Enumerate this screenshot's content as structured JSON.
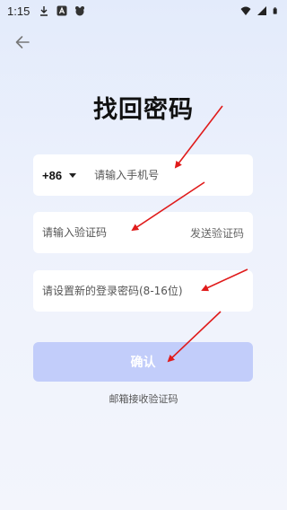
{
  "status_bar": {
    "time": "1:15",
    "left_icons": [
      "download-icon",
      "a-app-icon",
      "bear-app-icon"
    ],
    "right_icons": [
      "wifi-icon",
      "signal-icon",
      "battery-icon"
    ]
  },
  "header": {
    "back_icon": "arrow-left-icon",
    "title": "找回密码"
  },
  "form": {
    "country_code": "+86",
    "phone_placeholder": "请输入手机号",
    "code_placeholder": "请输入验证码",
    "send_code_label": "发送验证码",
    "password_placeholder": "请设置新的登录密码(8-16位)",
    "confirm_label": "确认",
    "email_link_label": "邮箱接收验证码"
  },
  "colors": {
    "confirm_button_disabled": "#c2cdfa",
    "annotation_arrow": "#e01b1b",
    "background_top": "#e3ebfb"
  }
}
